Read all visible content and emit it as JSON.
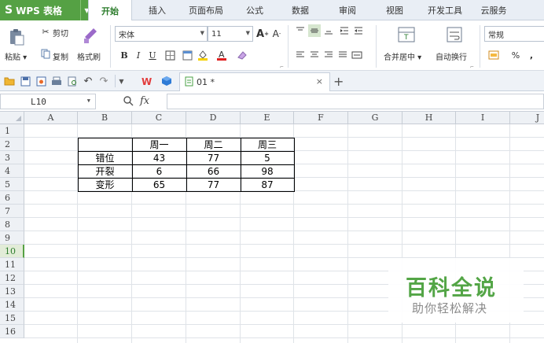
{
  "app": {
    "name": "WPS 表格",
    "logo_glyph": "S",
    "accent": "#55a144"
  },
  "menu_tabs": [
    "开始",
    "插入",
    "页面布局",
    "公式",
    "数据",
    "审阅",
    "视图",
    "开发工具",
    "云服务"
  ],
  "active_menu_tab": "开始",
  "ribbon": {
    "paste": "粘贴",
    "cut": "剪切",
    "copy": "复制",
    "format_painter": "格式刷",
    "font_name": "宋体",
    "font_size": "11",
    "bold": "B",
    "italic": "I",
    "underline": "U",
    "grow_font": "A",
    "shrink_font": "A",
    "merge_center": "合并居中",
    "wrap_text": "自动换行",
    "number_format": "常规",
    "percent": "%"
  },
  "quick_access": {
    "doc_tab": "01 *",
    "close": "×",
    "add_tab": "+"
  },
  "formula_bar": {
    "name_box": "L10",
    "fx": "fx",
    "formula": ""
  },
  "sheet": {
    "columns": [
      "A",
      "B",
      "C",
      "D",
      "E",
      "F",
      "G",
      "H",
      "I",
      "J"
    ],
    "rows": [
      "1",
      "2",
      "3",
      "4",
      "5",
      "6",
      "7",
      "8",
      "9",
      "10",
      "11",
      "12",
      "13",
      "14",
      "15",
      "16"
    ],
    "active_row": "10",
    "table": {
      "header": [
        "",
        "周一",
        "周二",
        "周三"
      ],
      "rows": [
        [
          "错位",
          "43",
          "77",
          "5"
        ],
        [
          "开裂",
          "6",
          "66",
          "98"
        ],
        [
          "变形",
          "65",
          "77",
          "87"
        ]
      ]
    }
  },
  "watermark": {
    "title": "百科全说",
    "subtitle": "助你轻松解决"
  }
}
